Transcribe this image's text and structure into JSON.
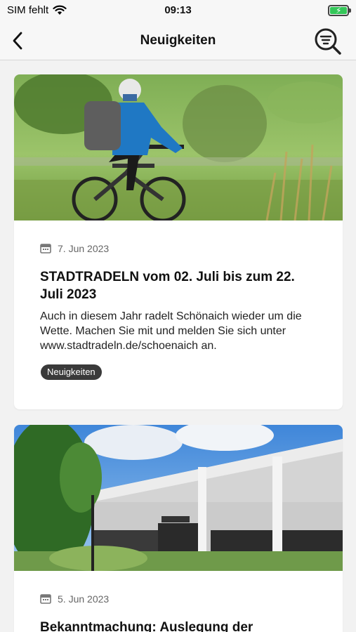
{
  "status_bar": {
    "carrier": "SIM fehlt",
    "time": "09:13",
    "battery_color": "#34c759"
  },
  "nav": {
    "back_icon": "chevron-left-icon",
    "title": "Neuigkeiten",
    "search_icon": "search-filter-icon"
  },
  "news": [
    {
      "date": "7. Jun 2023",
      "title": "STADTRADELN vom 02. Juli bis zum 22. Juli 2023",
      "text": "Auch in diesem Jahr radelt Schönaich wieder um die Wette. Machen Sie mit und melden Sie sich unter www.stadtradeln.de/schoenaich an.",
      "tag": "Neuigkeiten",
      "image": "cyclist-photo"
    },
    {
      "date": "5. Jun 2023",
      "title": "Bekanntmachung: Auslegung der",
      "image": "town-hall-photo"
    }
  ]
}
